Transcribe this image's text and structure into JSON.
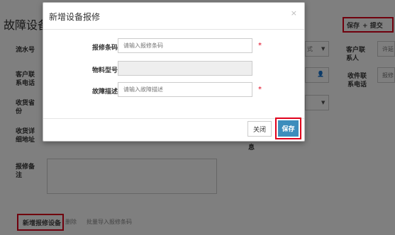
{
  "page": {
    "title": "故障设备",
    "save_label": "保存",
    "submit_label": "+ 提交",
    "fields": {
      "serial": "流水号",
      "customer_contact": "客户联系人",
      "customer_phone": "客户联系电话",
      "receiver_contact": "收件联系电话",
      "province": "收货省份",
      "address": "收货详细地址",
      "remark": "报修备注",
      "info_suffix": "息"
    },
    "bg_values": {
      "select_fragment": "式",
      "input_fragment_1": "许延",
      "input_fragment_2": "报修"
    },
    "bottom": {
      "add_device": "新增报修设备",
      "delete": "删除",
      "batch_import": "批量导入报修条码"
    }
  },
  "modal": {
    "title": "新增设备报修",
    "close_icon": "×",
    "fields": [
      {
        "label": "报修条码",
        "placeholder": "请输入报修条码",
        "required": true
      },
      {
        "label": "物料型号",
        "placeholder": "",
        "required": false
      },
      {
        "label": "故障描述",
        "placeholder": "请输入故障描述",
        "required": true
      }
    ],
    "required_mark": "*",
    "buttons": {
      "close": "关闭",
      "save": "保存"
    }
  },
  "colors": {
    "highlight": "#e0001b",
    "primary": "#3c8dbc"
  }
}
